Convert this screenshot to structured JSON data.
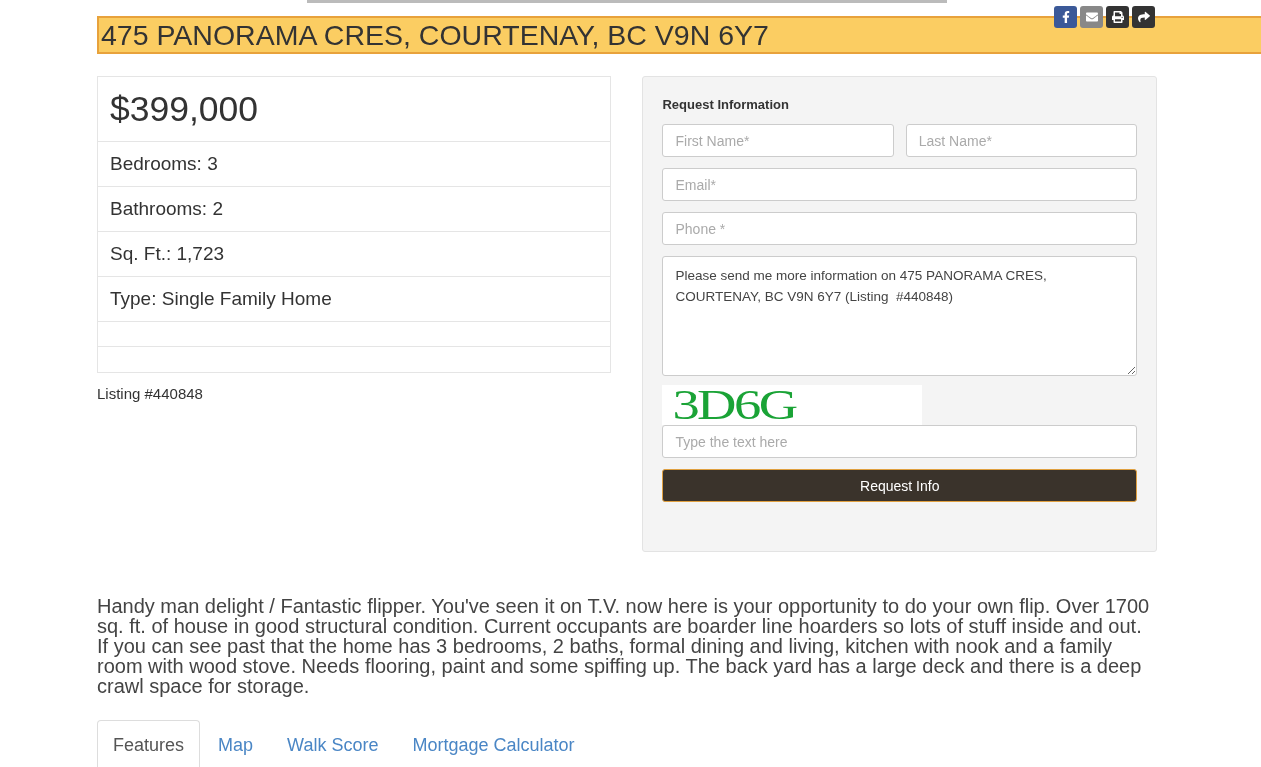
{
  "title": "475 PANORAMA CRES, COURTENAY, BC V9N 6Y7",
  "share": [
    {
      "kind": "facebook",
      "color": "#3b5998"
    },
    {
      "kind": "email",
      "color": "#888888"
    },
    {
      "kind": "print",
      "color": "#333333"
    },
    {
      "kind": "share",
      "color": "#333333"
    }
  ],
  "price": "$399,000",
  "facts": [
    "Bedrooms: 3",
    "Bathrooms: 2",
    "Sq. Ft.: 1,723",
    "Type: Single Family Home"
  ],
  "listing": "Listing #440848",
  "form": {
    "title": "Request Information",
    "first_name": {
      "placeholder": "First Name*"
    },
    "last_name": {
      "placeholder": "Last Name*"
    },
    "email": {
      "placeholder": "Email*"
    },
    "phone": {
      "placeholder": "Phone *"
    },
    "message": {
      "value": "Please send me more information on 475 PANORAMA CRES, COURTENAY, BC V9N 6Y7 (Listing  #440848)"
    },
    "captcha": "3D6G",
    "captcha_field": {
      "placeholder": "Type the text here"
    },
    "button": "Request Info"
  },
  "description": "Handy man delight / Fantastic flipper. You've seen it on T.V. now here is your opportunity to do your own flip. Over 1700 sq. ft. of house in good structural condition. Current occupants are boarder line hoarders so lots of stuff inside and out. If you can see past that the home has 3 bedrooms, 2 baths, formal dining and living, kitchen with nook and a family room with wood stove. Needs flooring, paint and some spiffing up. The back yard has a large deck and there is a deep crawl space for storage.",
  "tabs": [
    {
      "label": "Features",
      "selected": true
    },
    {
      "label": "Map",
      "selected": false
    },
    {
      "label": "Walk Score",
      "selected": false
    },
    {
      "label": "Mortgage Calculator",
      "selected": false
    }
  ]
}
